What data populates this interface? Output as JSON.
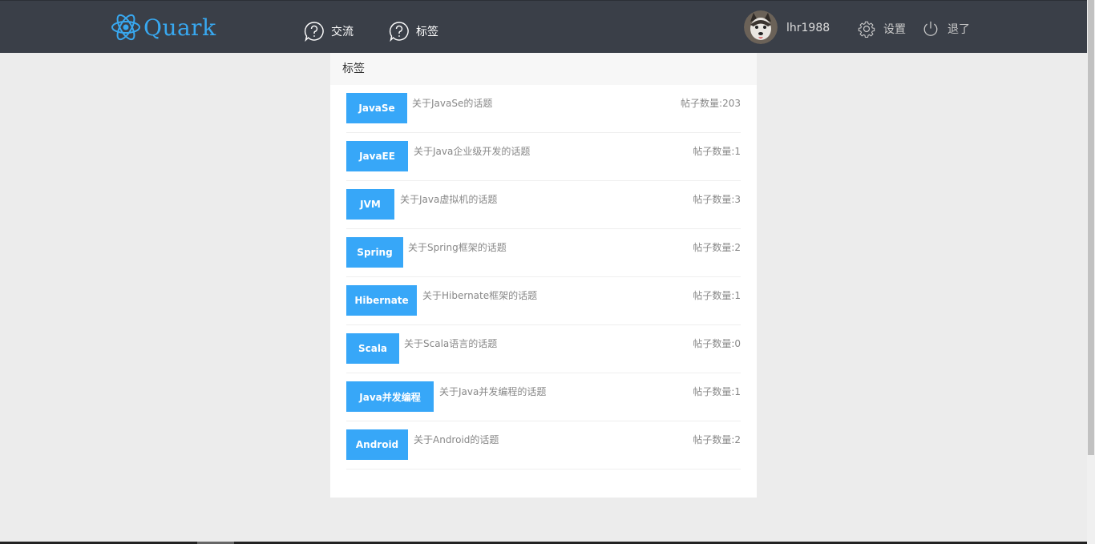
{
  "brand": {
    "name": "Quark",
    "color": "#38a8f0"
  },
  "nav": {
    "links": [
      {
        "label": "交流",
        "icon": "question-bubble-icon"
      },
      {
        "label": "标签",
        "icon": "question-bubble-icon"
      }
    ]
  },
  "user": {
    "username": "lhr1988",
    "avatar_icon": "husky-avatar",
    "settings_label": "设置",
    "logout_label": "退了"
  },
  "panel": {
    "title": "标签",
    "tags": [
      {
        "name": "JavaSe",
        "description": "关于JavaSe的话题",
        "count": "帖子数量:203"
      },
      {
        "name": "JavaEE",
        "description": "关于Java企业级开发的话题",
        "count": "帖子数量:1"
      },
      {
        "name": "JVM",
        "description": "关于Java虚拟机的话题",
        "count": "帖子数量:3"
      },
      {
        "name": "Spring",
        "description": "关于Spring框架的话题",
        "count": "帖子数量:2"
      },
      {
        "name": "Hibernate",
        "description": "关于Hibernate框架的话题",
        "count": "帖子数量:1"
      },
      {
        "name": "Scala",
        "description": "关于Scala语言的话题",
        "count": "帖子数量:0"
      },
      {
        "name": "Java并发编程",
        "description": "关于Java并发编程的话题",
        "count": "帖子数量:1"
      },
      {
        "name": "Android",
        "description": "关于Android的话题",
        "count": "帖子数量:2"
      }
    ]
  },
  "colors": {
    "navbar": "#3a3f48",
    "tag_button": "#37a7f8",
    "background": "#ececec"
  }
}
